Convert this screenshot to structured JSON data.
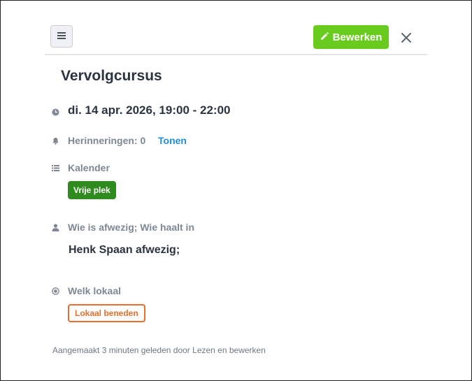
{
  "toolbar": {
    "menu_icon": "hamburger-icon",
    "edit_label": "Bewerken",
    "edit_icon": "pencil-icon",
    "close_icon": "close-icon",
    "accent_color": "#6acb1f"
  },
  "event": {
    "title": "Vervolgcursus",
    "datetime": "di. 14 apr. 2026, 19:00 - 22:00",
    "reminders_label": "Herinneringen: 0",
    "reminders_link": "Tonen",
    "calendar_label": "Kalender",
    "calendar_badge": "Vrije plek",
    "calendar_badge_color": "#2f8b1e",
    "absence_label": "Wie is afwezig; Wie haalt in",
    "absence_value": "Henk Spaan afwezig;",
    "location_label": "Welk lokaal",
    "location_badge": "Lokaal beneden",
    "location_badge_color": "#e96f2e"
  },
  "footer": {
    "created_text": "Aangemaakt 3 minuten geleden door Lezen en bewerken"
  }
}
